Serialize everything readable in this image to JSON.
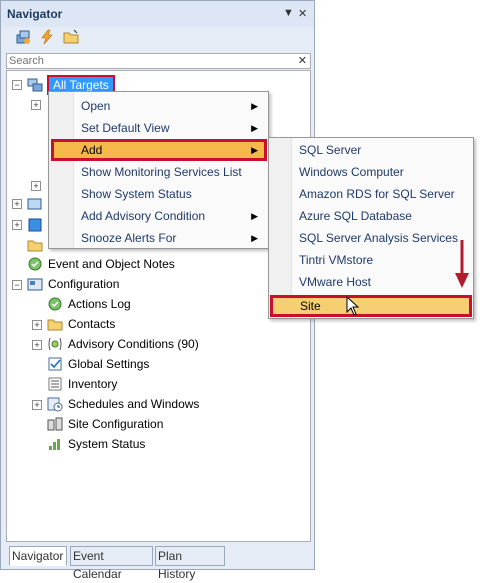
{
  "navigator": {
    "title": "Navigator",
    "pin_icon": "pin-icon",
    "close_icon": "close-icon",
    "toolbar": [
      "add-targets-icon",
      "lightning-icon",
      "folder-icon"
    ],
    "search": {
      "placeholder": "Search",
      "value": ""
    }
  },
  "tree": {
    "root_label": "All Targets",
    "items": [
      {
        "label": "Event and Object Notes",
        "icon": "notes-icon"
      },
      {
        "label": "Configuration",
        "icon": "configuration-icon"
      },
      {
        "label": "Actions Log",
        "icon": "actions-log-icon"
      },
      {
        "label": "Contacts",
        "icon": "contacts-icon"
      },
      {
        "label": "Advisory Conditions (90)",
        "icon": "advisory-icon"
      },
      {
        "label": "Global Settings",
        "icon": "checkbox-icon"
      },
      {
        "label": "Inventory",
        "icon": "inventory-icon"
      },
      {
        "label": "Schedules and Windows",
        "icon": "schedule-icon"
      },
      {
        "label": "Site Configuration",
        "icon": "site-config-icon"
      },
      {
        "label": "System Status",
        "icon": "status-icon"
      }
    ]
  },
  "context_menu": {
    "items": [
      {
        "label": "Open",
        "submenu": true
      },
      {
        "label": "Set Default View",
        "submenu": true
      },
      {
        "label": "Add",
        "submenu": true
      },
      {
        "label": "Show Monitoring Services List",
        "submenu": false
      },
      {
        "label": "Show System Status",
        "submenu": false
      },
      {
        "label": "Add Advisory Condition",
        "submenu": true
      },
      {
        "label": "Snooze Alerts For",
        "submenu": true
      }
    ]
  },
  "sub_menu": {
    "items": [
      {
        "label": "SQL Server"
      },
      {
        "label": "Windows Computer"
      },
      {
        "label": "Amazon RDS for SQL Server"
      },
      {
        "label": "Azure SQL Database"
      },
      {
        "label": "SQL Server Analysis Services"
      },
      {
        "label": "Tintri VMstore"
      },
      {
        "label": "VMware Host"
      },
      {
        "label": "Site"
      }
    ]
  },
  "tabs": [
    {
      "label": "Navigator"
    },
    {
      "label": "Event Calendar"
    },
    {
      "label": "Plan History"
    }
  ],
  "colors": {
    "highlight_border": "#c8102e",
    "selected_bg": "#3399ff",
    "menu_highlight": "#f6b84b",
    "annotation_arrow": "#b01c2e"
  }
}
